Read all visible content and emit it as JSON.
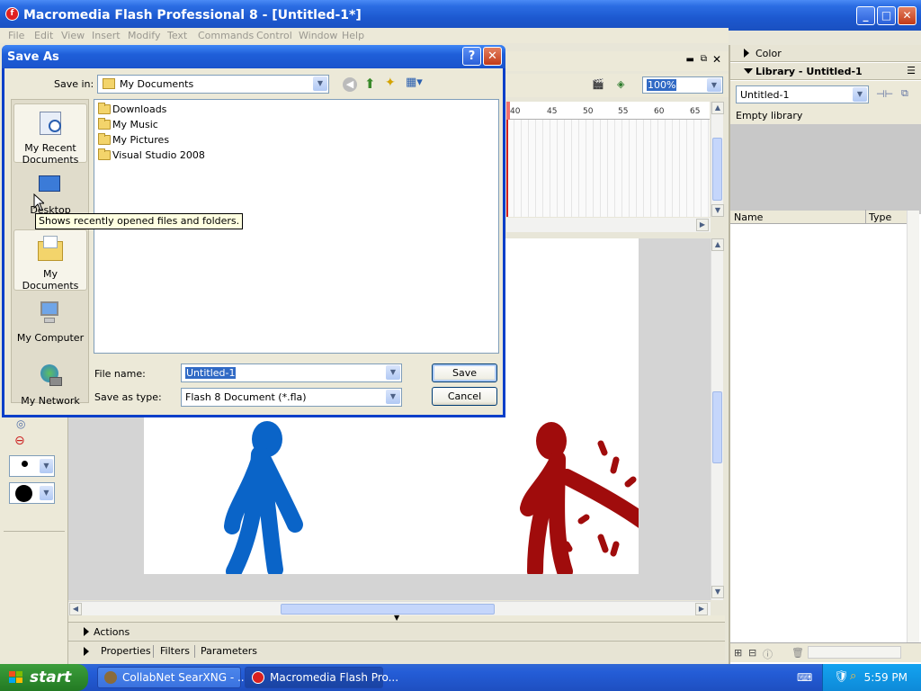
{
  "window": {
    "title": "Macromedia Flash Professional 8 - [Untitled-1*]",
    "app_icon_glyph": "f"
  },
  "menu": [
    "File",
    "Edit",
    "View",
    "Insert",
    "Modify",
    "Text",
    "Commands",
    "Control",
    "Window",
    "Help"
  ],
  "right_panel": {
    "color_label": "Color",
    "library_label": "Library - Untitled-1",
    "library_select": "Untitled-1",
    "empty_library": "Empty library",
    "col_name": "Name",
    "col_type": "Type"
  },
  "timeline": {
    "zoom": "100%",
    "ruler_ticks": [
      "40",
      "45",
      "50",
      "55",
      "60",
      "65"
    ]
  },
  "bottom_panels": {
    "actions": "Actions",
    "properties": "Properties",
    "filters": "Filters",
    "parameters": "Parameters"
  },
  "taskbar": {
    "start": "start",
    "items": [
      {
        "label": "CollabNet SearXNG - ...",
        "active": false
      },
      {
        "label": "Macromedia Flash Pro...",
        "active": true
      }
    ],
    "clock": "5:59 PM"
  },
  "dialog": {
    "title": "Save As",
    "save_in_label": "Save in:",
    "save_in_value": "My Documents",
    "places": [
      "My Recent Documents",
      "Desktop",
      "My Documents",
      "My Computer",
      "My Network"
    ],
    "files": [
      "Downloads",
      "My Music",
      "My Pictures",
      "Visual Studio 2008"
    ],
    "file_name_label": "File name:",
    "file_name_value": "Untitled-1",
    "save_type_label": "Save as type:",
    "save_type_value": "Flash 8 Document (*.fla)",
    "save_button": "Save",
    "cancel_button": "Cancel",
    "tooltip": "Shows recently opened files and folders."
  },
  "colors": {
    "stick_figure_left": "#0a64c8",
    "stick_figure_right": "#a00c0c"
  }
}
